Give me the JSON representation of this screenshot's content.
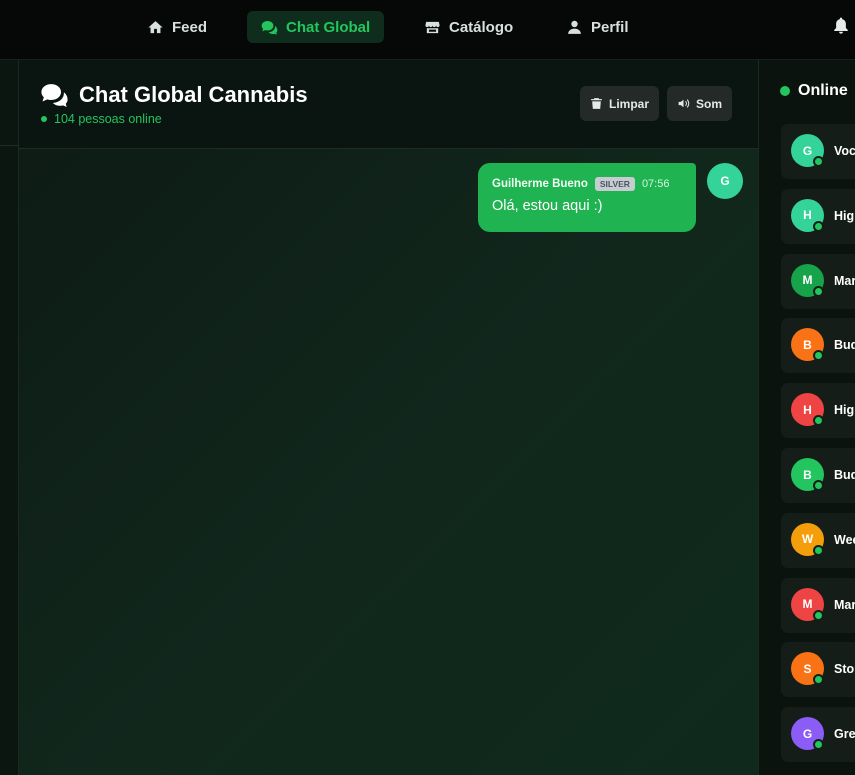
{
  "nav": {
    "items": [
      {
        "label": "Feed",
        "icon": "home-icon",
        "active": false
      },
      {
        "label": "Chat Global",
        "icon": "comments-icon",
        "active": true
      },
      {
        "label": "Catálogo",
        "icon": "store-icon",
        "active": false
      },
      {
        "label": "Perfil",
        "icon": "user-icon",
        "active": false
      }
    ],
    "bell_icon": "bell-icon"
  },
  "chat": {
    "title": "Chat Global Cannabis",
    "online_text": "104 pessoas online",
    "buttons": {
      "clear_label": "Limpar",
      "sound_label": "Som"
    },
    "messages": [
      {
        "author": "Guilherme Bueno",
        "badge": "SILVER",
        "time": "07:56",
        "text": "Olá, estou aqui :)",
        "avatar_initial": "G",
        "avatar_color": "#34d399"
      }
    ]
  },
  "online": {
    "title": "Online",
    "users": [
      {
        "initial": "G",
        "name": "Voc",
        "color": "#34d399"
      },
      {
        "initial": "H",
        "name": "High",
        "color": "#34d399"
      },
      {
        "initial": "M",
        "name": "Mar",
        "color": "#16a34a"
      },
      {
        "initial": "B",
        "name": "Bud",
        "color": "#f97316"
      },
      {
        "initial": "H",
        "name": "High",
        "color": "#ef4444"
      },
      {
        "initial": "B",
        "name": "Bud",
        "color": "#22c55e"
      },
      {
        "initial": "W",
        "name": "Wee",
        "color": "#f59e0b"
      },
      {
        "initial": "M",
        "name": "Mar",
        "color": "#ef4444"
      },
      {
        "initial": "S",
        "name": "Stor",
        "color": "#f97316"
      },
      {
        "initial": "G",
        "name": "Gre",
        "color": "#8b5cf6"
      }
    ]
  },
  "colors": {
    "accent": "#22c55e",
    "bubble": "#1fb451"
  }
}
